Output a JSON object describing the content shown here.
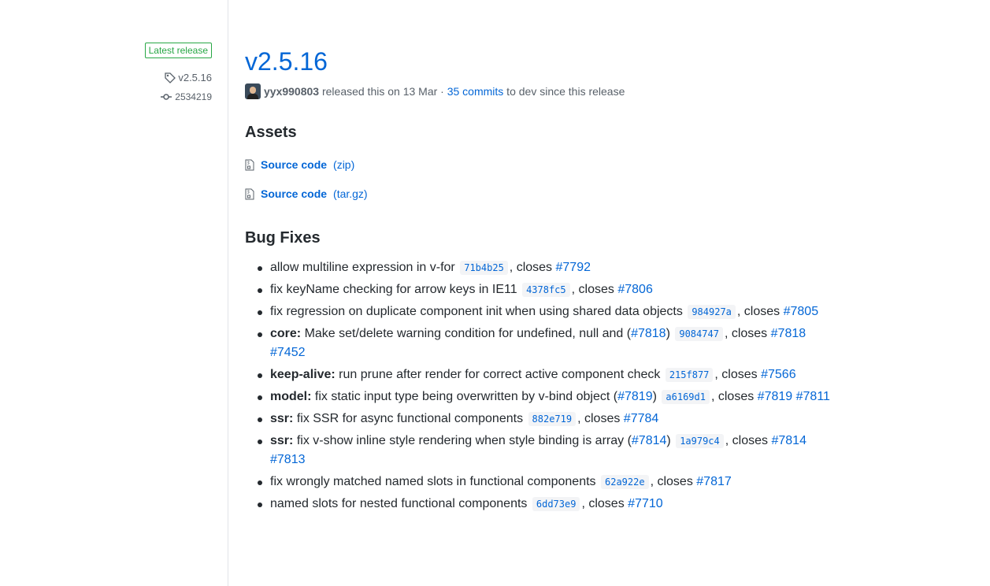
{
  "sidebar": {
    "badge": "Latest release",
    "tag": "v2.5.16",
    "commit": "2534219"
  },
  "release": {
    "title": "v2.5.16",
    "author": "yyx990803",
    "released_text": " released this on 13 Mar · ",
    "commits_link": "35 commits",
    "commits_suffix": " to dev since this release"
  },
  "assets": {
    "heading": "Assets",
    "items": [
      {
        "label": "Source code",
        "ext": "(zip)"
      },
      {
        "label": "Source code",
        "ext": "(tar.gz)"
      }
    ]
  },
  "bugfixes": {
    "heading": "Bug Fixes",
    "items": [
      {
        "scope": "",
        "text": "allow multiline expression in v-for",
        "ref": "",
        "hash": "71b4b25",
        "closes": [
          "#7792"
        ]
      },
      {
        "scope": "",
        "text": "fix keyName checking for arrow keys in IE11",
        "ref": "",
        "hash": "4378fc5",
        "closes": [
          "#7806"
        ]
      },
      {
        "scope": "",
        "text": "fix regression on duplicate component init when using shared data objects",
        "ref": "",
        "hash": "984927a",
        "closes": [
          "#7805"
        ]
      },
      {
        "scope": "core:",
        "text": "Make set/delete warning condition for undefined, null and",
        "ref": "#7818",
        "hash": "9084747",
        "closes": [
          "#7818",
          "#7452"
        ]
      },
      {
        "scope": "keep-alive:",
        "text": "run prune after render for correct active component check",
        "ref": "",
        "hash": "215f877",
        "closes": [
          "#7566"
        ]
      },
      {
        "scope": "model:",
        "text": "fix static input type being overwritten by v-bind object",
        "ref": "#7819",
        "hash": "a6169d1",
        "closes": [
          "#7819",
          "#7811"
        ]
      },
      {
        "scope": "ssr:",
        "text": "fix SSR for async functional components",
        "ref": "",
        "hash": "882e719",
        "closes": [
          "#7784"
        ]
      },
      {
        "scope": "ssr:",
        "text": "fix v-show inline style rendering when style binding is array",
        "ref": "#7814",
        "hash": "1a979c4",
        "closes": [
          "#7814",
          "#7813"
        ]
      },
      {
        "scope": "",
        "text": "fix wrongly matched named slots in functional components",
        "ref": "",
        "hash": "62a922e",
        "closes": [
          "#7817"
        ]
      },
      {
        "scope": "",
        "text": "named slots for nested functional components",
        "ref": "",
        "hash": "6dd73e9",
        "closes": [
          "#7710"
        ]
      }
    ],
    "closes_word": ", closes"
  },
  "colors": {
    "link": "#0366d6",
    "badge": "#28a745",
    "code_bg": "#f3f4f6",
    "muted": "#586069"
  }
}
